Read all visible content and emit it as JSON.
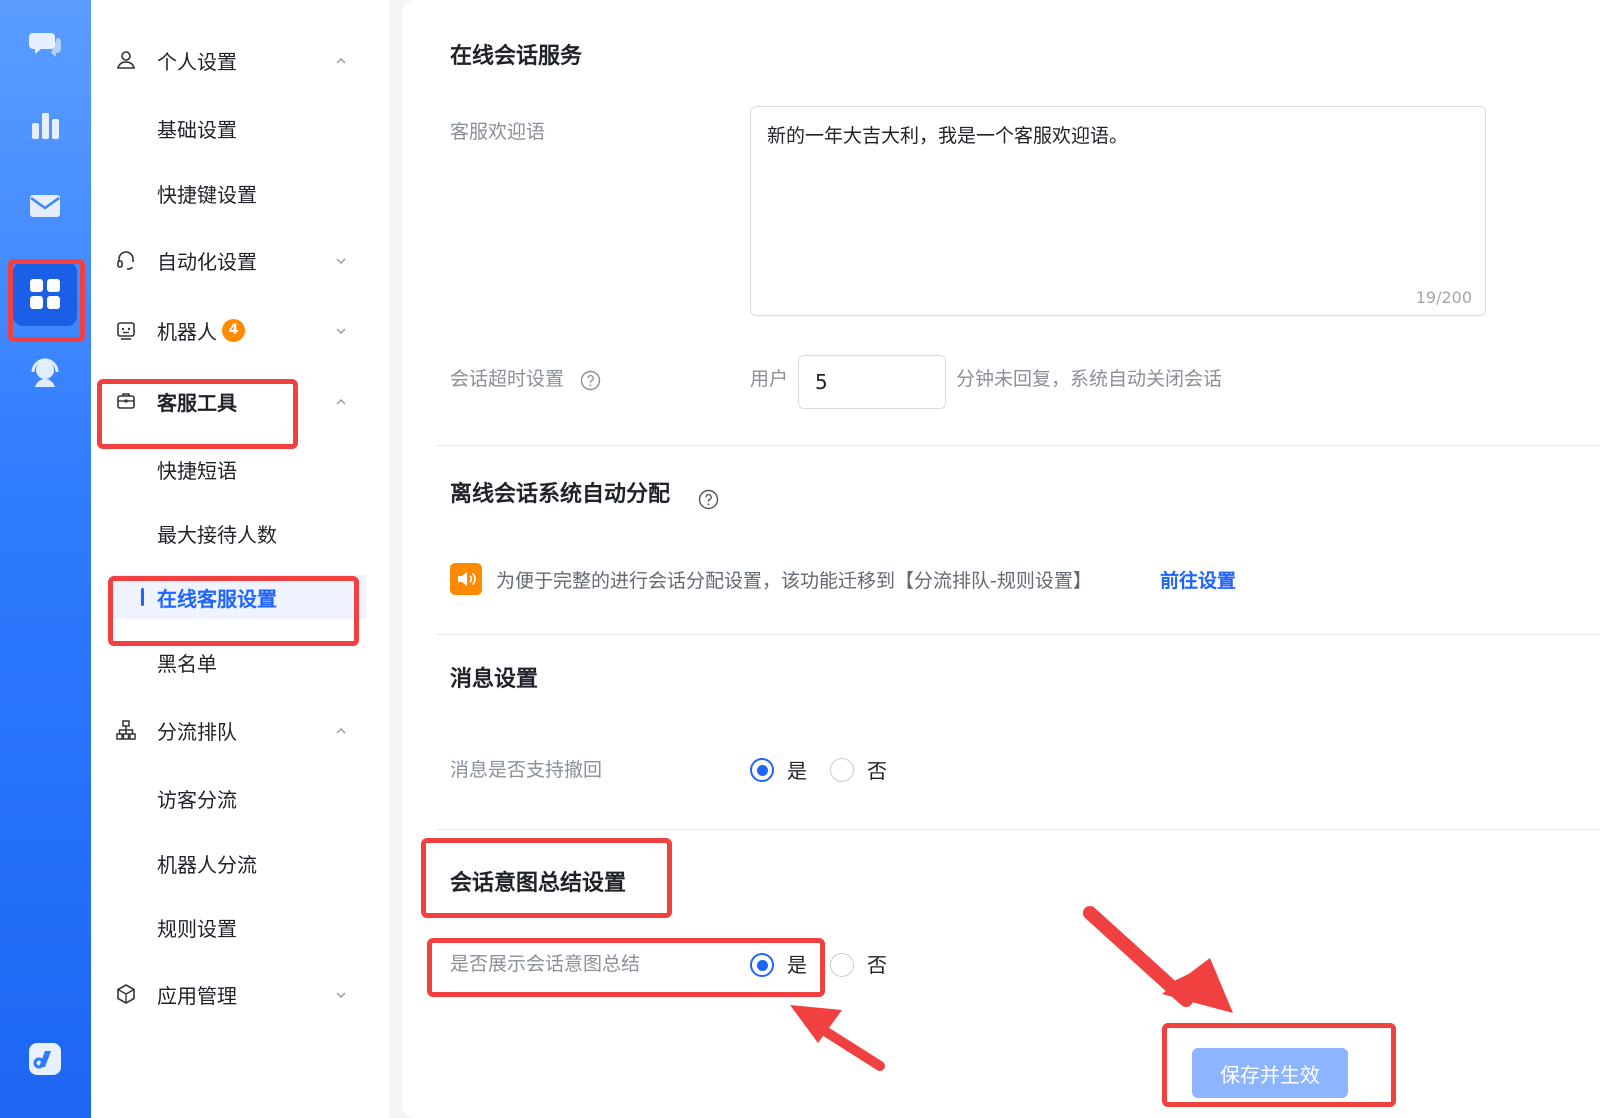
{
  "rail": {
    "items": [
      {
        "icon": "chat-bubbles-icon"
      },
      {
        "icon": "bar-chart-icon"
      },
      {
        "icon": "mail-icon"
      },
      {
        "icon": "apps-grid-icon",
        "active": true
      },
      {
        "icon": "agent-headset-icon"
      }
    ],
    "bottom_icon": "brand-logo-icon"
  },
  "sidebar": {
    "groups": [
      {
        "label": "个人设置",
        "icon": "user-icon",
        "expanded": true,
        "items": [
          "基础设置",
          "快捷键设置"
        ]
      },
      {
        "label": "自动化设置",
        "icon": "headset-icon",
        "expanded": false
      },
      {
        "label": "机器人",
        "icon": "robot-icon",
        "badge": "4",
        "expanded": false
      },
      {
        "label": "客服工具",
        "icon": "toolbox-icon",
        "expanded": true,
        "items": [
          "快捷短语",
          "最大接待人数",
          "在线客服设置",
          "黑名单"
        ],
        "active_item": "在线客服设置"
      },
      {
        "label": "分流排队",
        "icon": "org-chart-icon",
        "expanded": true,
        "items": [
          "访客分流",
          "机器人分流",
          "规则设置"
        ]
      },
      {
        "label": "应用管理",
        "icon": "cube-icon",
        "expanded": false
      }
    ]
  },
  "main": {
    "online_service": {
      "title": "在线会话服务",
      "greeting_label": "客服欢迎语",
      "greeting_value": "新的一年大吉大利，我是一个客服欢迎语。",
      "greeting_counter": "19/200",
      "timeout_label": "会话超时设置",
      "timeout_prefix": "用户",
      "timeout_value": "5",
      "timeout_suffix": "分钟未回复，系统自动关闭会话"
    },
    "offline_assign": {
      "title": "离线会话系统自动分配",
      "notice": "为便于完整的进行会话分配设置，该功能迁移到【分流排队-规则设置】",
      "link": "前往设置"
    },
    "message_settings": {
      "title": "消息设置",
      "recall_label": "消息是否支持撤回",
      "yes": "是",
      "no": "否",
      "selected": "是"
    },
    "intent_summary": {
      "title": "会话意图总结设置",
      "show_label": "是否展示会话意图总结",
      "yes": "是",
      "no": "否",
      "selected": "是"
    },
    "save_button": "保存并生效"
  },
  "colors": {
    "accent": "#1f64ff",
    "rail_top": "#5b9dff",
    "rail_bottom": "#1c66f2",
    "annotation": "#f04040",
    "badge": "#ff8a00",
    "save_button": "#8db5ff"
  }
}
